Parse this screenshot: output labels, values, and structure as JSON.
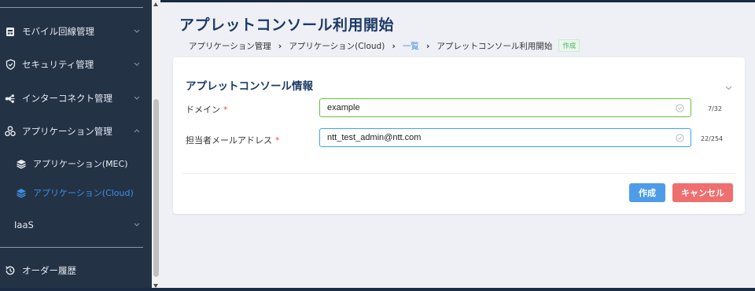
{
  "sidebar": {
    "items": [
      {
        "label": "モバイル回線管理",
        "icon": "sim-card-icon"
      },
      {
        "label": "セキュリティ管理",
        "icon": "shield-check-icon"
      },
      {
        "label": "インターコネクト管理",
        "icon": "network-icon"
      },
      {
        "label": "アプリケーション管理",
        "icon": "apps-icon"
      }
    ],
    "sub_items": [
      {
        "label": "アプリケーション(MEC)",
        "icon": "layers-icon"
      },
      {
        "label": "アプリケーション(Cloud)",
        "icon": "layers-icon"
      }
    ],
    "iaas_label": "IaaS",
    "order_history_label": "オーダー履歴"
  },
  "page": {
    "title": "アプレットコンソール利用開始"
  },
  "breadcrumb": {
    "items": [
      "アプリケーション管理",
      "アプリケーション(Cloud)",
      "一覧",
      "アプレットコンソール利用開始"
    ],
    "badge": "作成"
  },
  "form": {
    "section_title": "アプレットコンソール情報",
    "domain_label": "ドメイン",
    "domain_value": "example",
    "domain_counter": "7/32",
    "email_label": "担当者メールアドレス",
    "email_value": "ntt_test_admin@ntt.com",
    "email_counter": "22/254",
    "required_mark": "*",
    "create_button": "作成",
    "cancel_button": "キャンセル"
  },
  "colors": {
    "sidebar_bg": "#243246",
    "accent": "#3f8ee6",
    "title": "#1d3a66",
    "create": "#4e9ce8",
    "cancel": "#ef6e6e",
    "valid": "#67c23a"
  }
}
